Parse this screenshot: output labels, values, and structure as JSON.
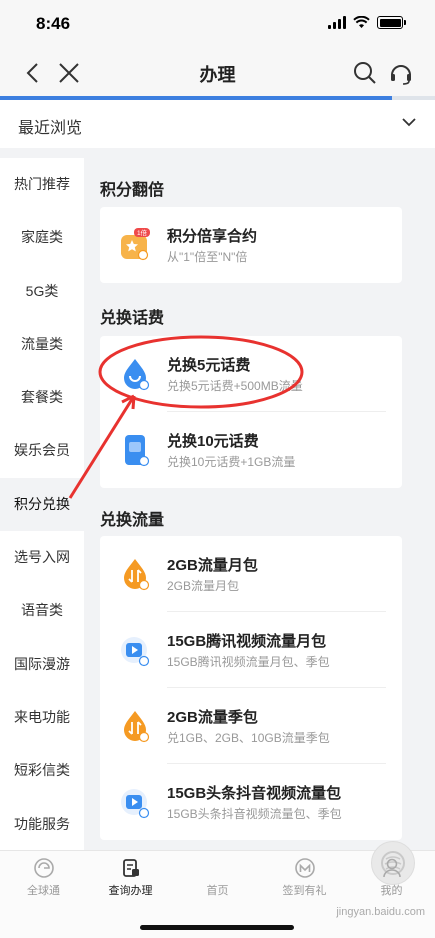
{
  "status": {
    "time": "8:46"
  },
  "nav": {
    "title": "办理",
    "back_icon": "chevron-left-icon",
    "close_icon": "close-icon",
    "search_icon": "search-icon",
    "service_icon": "headset-icon"
  },
  "page_progress": 0.9,
  "recent": {
    "label": "最近浏览"
  },
  "sidebar": {
    "items": [
      {
        "label": "热门推荐"
      },
      {
        "label": "家庭类"
      },
      {
        "label": "5G类"
      },
      {
        "label": "流量类"
      },
      {
        "label": "套餐类"
      },
      {
        "label": "娱乐会员"
      },
      {
        "label": "积分兑换",
        "active": true
      },
      {
        "label": "选号入网"
      },
      {
        "label": "语音类"
      },
      {
        "label": "国际漫游"
      },
      {
        "label": "来电功能"
      },
      {
        "label": "短彩信类"
      },
      {
        "label": "功能服务"
      }
    ]
  },
  "sections": {
    "double": {
      "title": "积分翻倍",
      "items": [
        {
          "title": "积分倍享合约",
          "subtitle": "从\"1\"倍至\"N\"倍",
          "badge": "1倍"
        }
      ]
    },
    "fee": {
      "title": "兑换话费",
      "items": [
        {
          "title": "兑换5元话费",
          "subtitle": "兑换5元话费+500MB流量"
        },
        {
          "title": "兑换10元话费",
          "subtitle": "兑换10元话费+1GB流量"
        }
      ]
    },
    "data": {
      "title": "兑换流量",
      "items": [
        {
          "title": "2GB流量月包",
          "subtitle": "2GB流量月包"
        },
        {
          "title": "15GB腾讯视频流量月包",
          "subtitle": "15GB腾讯视频流量月包、季包"
        },
        {
          "title": "2GB流量季包",
          "subtitle": "兑1GB、2GB、10GB流量季包"
        },
        {
          "title": "15GB头条抖音视频流量包",
          "subtitle": "15GB头条抖音视频流量包、季包"
        }
      ]
    }
  },
  "tabbar": {
    "items": [
      {
        "label": "全球通"
      },
      {
        "label": "查询办理",
        "active": true
      },
      {
        "label": "首页"
      },
      {
        "label": "签到有礼"
      },
      {
        "label": "我的"
      }
    ]
  },
  "watermark": "jingyan.baidu.com",
  "colors": {
    "accent": "#3d7fe0",
    "annotation": "#e8322f",
    "orange": "#f59a23",
    "blue": "#3a8ef0"
  }
}
